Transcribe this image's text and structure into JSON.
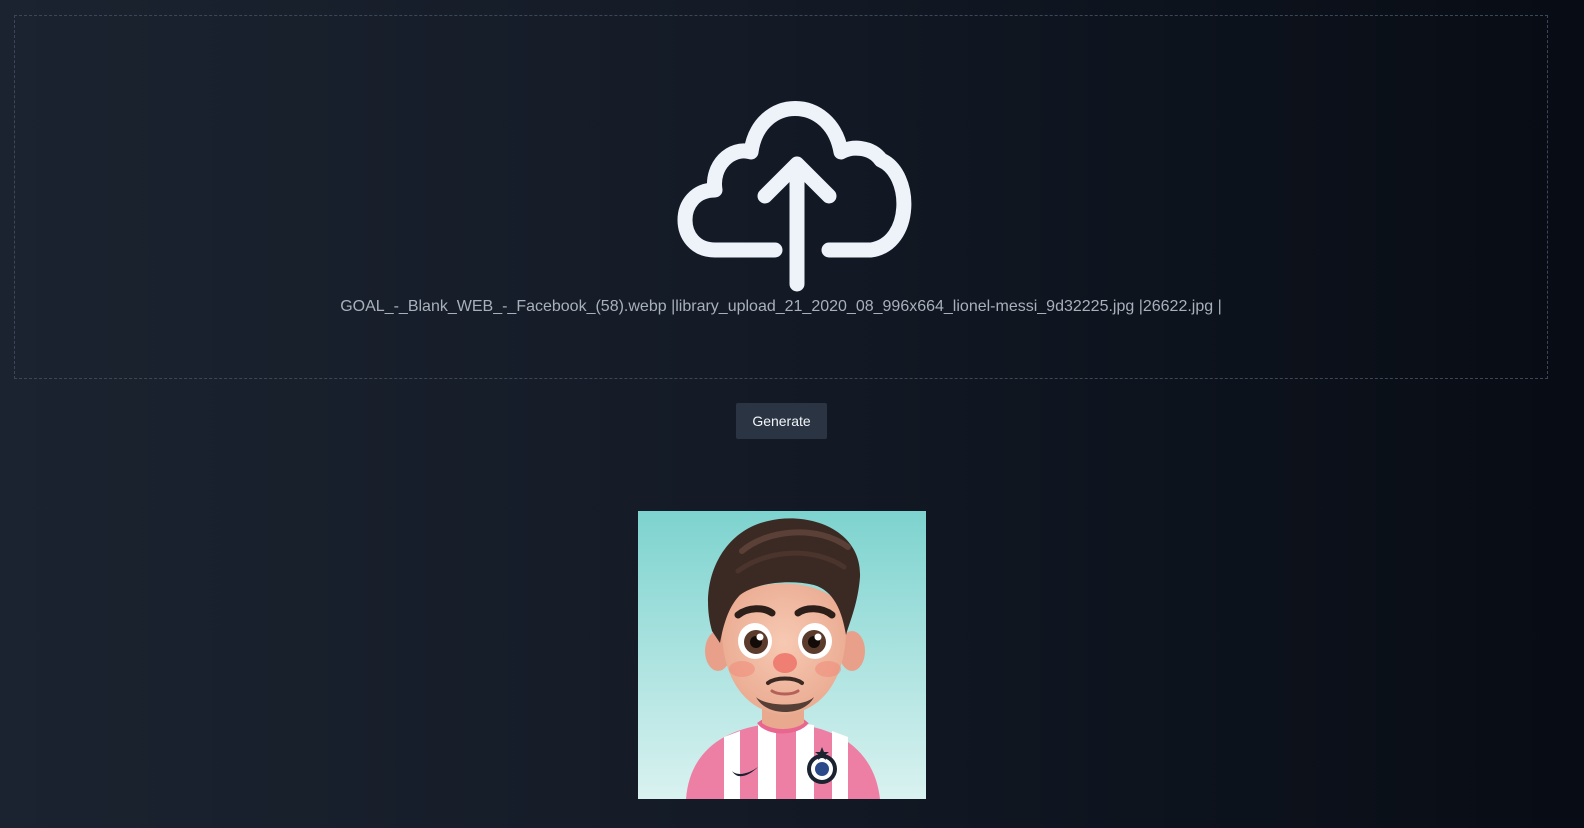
{
  "upload": {
    "icon": "cloud-upload-icon",
    "file_list": "GOAL_-_Blank_WEB_-_Facebook_(58).webp |library_upload_21_2020_08_996x664_lionel-messi_9d32225.jpg |26622.jpg |"
  },
  "actions": {
    "generate_label": "Generate"
  },
  "result": {
    "image_description": "cartoon-avatar"
  },
  "colors": {
    "background_left": "#1b2330",
    "background_right": "#080c14",
    "dropzone_border": "#3c4656",
    "button_bg": "#2a3443",
    "icon_color": "#eef2f9",
    "avatar_bg_top": "#7dd3cf",
    "avatar_bg_bottom": "#d9f2f0",
    "jersey_pink": "#ee7fa4"
  }
}
